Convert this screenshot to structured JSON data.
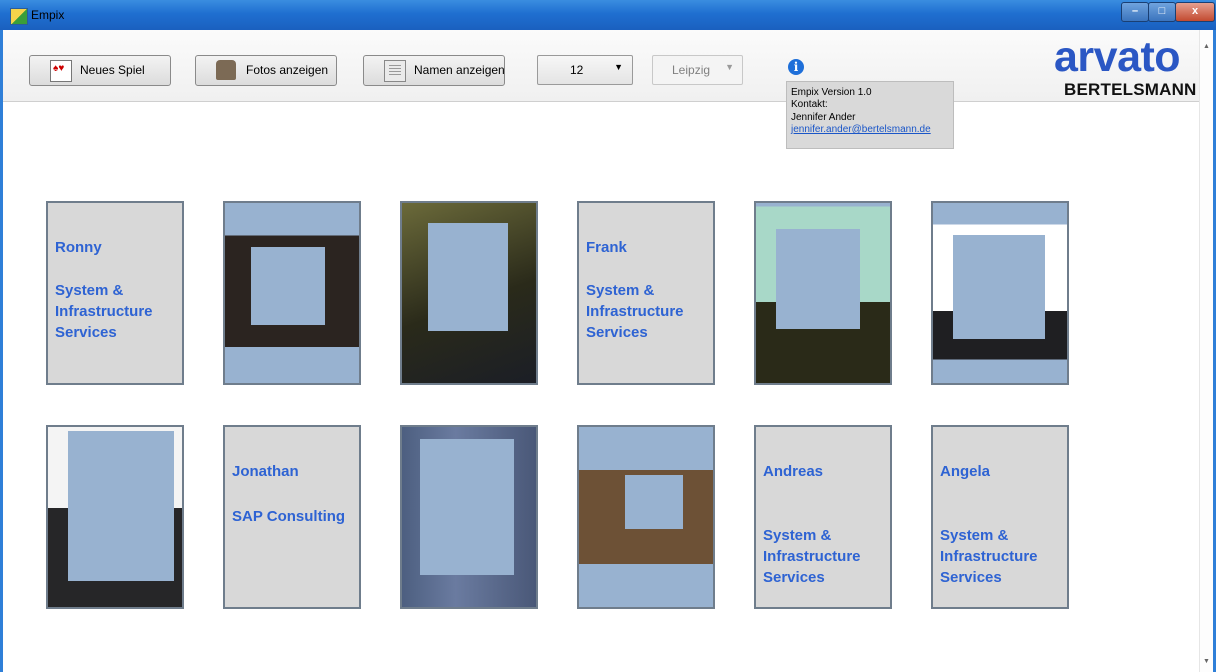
{
  "window": {
    "title": "Empix",
    "minimize_label": "–",
    "maximize_label": "□",
    "close_label": "x"
  },
  "toolbar": {
    "new_game_label": "Neues Spiel",
    "show_photos_label": "Fotos anzeigen",
    "show_names_label": "Namen anzeigen",
    "count_value": "12",
    "location_value": "Leipzig",
    "dropdown_arrow": "▼"
  },
  "info": {
    "icon_glyph": "i",
    "version": "Empix Version 1.0",
    "contact": "Kontakt:",
    "name": "Jennifer Ander",
    "email": "jennifer.ander@bertelsmann.de"
  },
  "logo": {
    "main": "arvato",
    "sub": "BERTELSMANN",
    "brand_color": "#2b57c4"
  },
  "cards": [
    {
      "type": "name",
      "name": "Ronny",
      "department": "System & Infrastructure Services"
    },
    {
      "type": "photo"
    },
    {
      "type": "photo"
    },
    {
      "type": "name",
      "name": "Frank",
      "department": "System & Infrastructure Services"
    },
    {
      "type": "photo"
    },
    {
      "type": "photo"
    },
    {
      "type": "photo"
    },
    {
      "type": "name",
      "name": "Jonathan",
      "department": "SAP Consulting"
    },
    {
      "type": "photo"
    },
    {
      "type": "photo"
    },
    {
      "type": "name",
      "name": "Andreas",
      "department": "System & Infrastructure Services"
    },
    {
      "type": "name",
      "name": "Angela",
      "department": "System & Infrastructure Services"
    }
  ],
  "colors": {
    "name_text": "#2e63d3",
    "card_background": "#d8d8d8",
    "card_border": "#6f7d8c",
    "redaction": "#98b2d0"
  },
  "scrollbar": {
    "up_glyph": "▲",
    "down_glyph": "▼"
  }
}
